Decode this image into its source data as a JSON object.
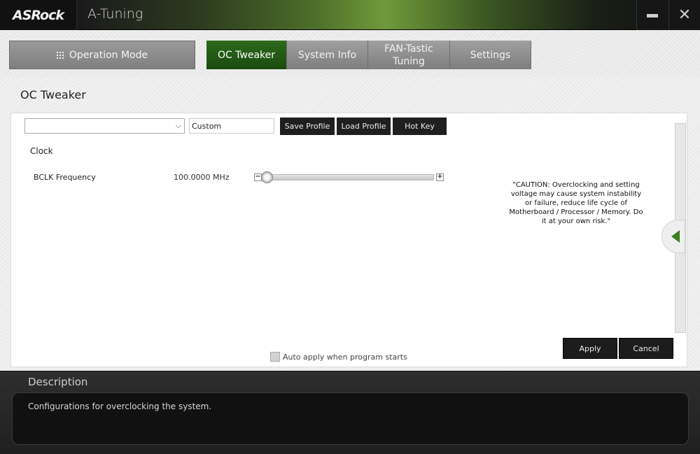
{
  "window": {
    "brand": "ASRock",
    "title": "A-Tuning",
    "minimize_icon": "minimize-icon",
    "close_icon": "close-icon"
  },
  "nav": {
    "operation_mode": "Operation Mode",
    "tabs": [
      {
        "label": "OC Tweaker",
        "active": true
      },
      {
        "label": "System Info",
        "active": false
      },
      {
        "label": "FAN-Tastic Tuning",
        "active": false
      },
      {
        "label": "Settings",
        "active": false
      }
    ]
  },
  "page": {
    "title": "OC Tweaker"
  },
  "profile": {
    "selected": "",
    "name_value": "Custom",
    "save_label": "Save Profile",
    "load_label": "Load Profile",
    "hotkey_label": "Hot Key"
  },
  "clock": {
    "section_label": "Clock",
    "bclk_label": "BCLK Frequency",
    "bclk_value": "100.0000 MHz",
    "slider_fraction": 0.0
  },
  "caution": "\"CAUTION: Overclocking and setting voltage may cause system instability or failure, reduce life cycle of Motherboard / Processor / Memory. Do it at your own risk.\"",
  "actions": {
    "auto_apply_label": "Auto apply when program starts",
    "auto_apply_checked": false,
    "apply_label": "Apply",
    "cancel_label": "Cancel"
  },
  "description": {
    "title": "Description",
    "text": "Configurations for overclocking the system."
  },
  "colors": {
    "accent": "#2d6a1c",
    "arrow": "#3b7d22"
  }
}
